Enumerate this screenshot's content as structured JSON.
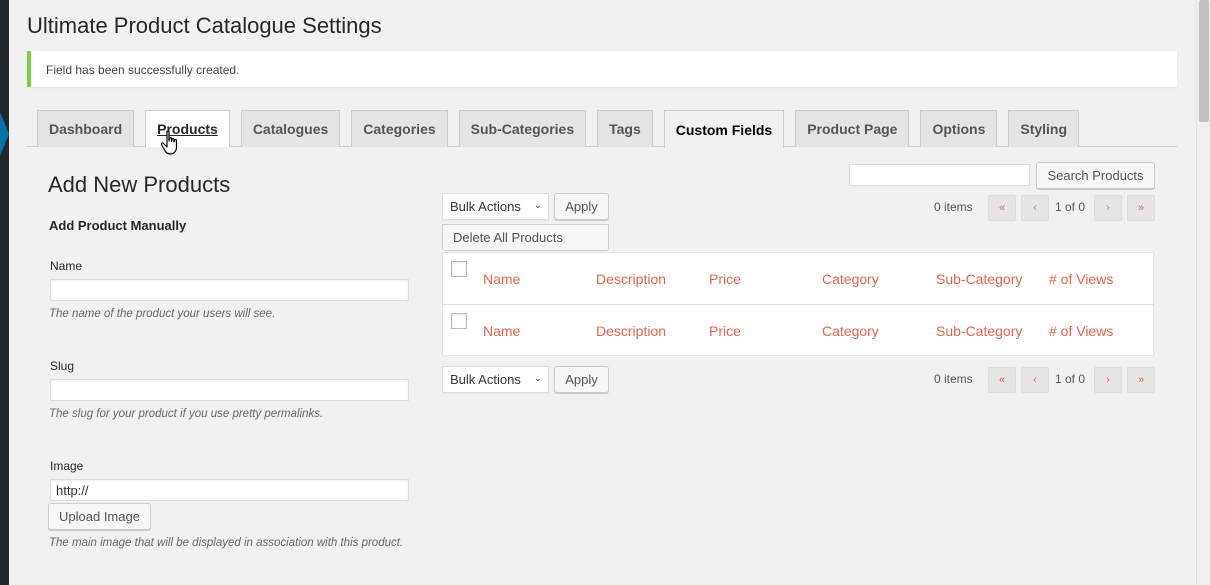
{
  "page": {
    "title": "Ultimate Product Catalogue Settings",
    "notice": "Field has been successfully created."
  },
  "tabs": [
    {
      "label": "Dashboard"
    },
    {
      "label": "Products"
    },
    {
      "label": "Catalogues"
    },
    {
      "label": "Categories"
    },
    {
      "label": "Sub-Categories"
    },
    {
      "label": "Tags"
    },
    {
      "label": "Custom Fields"
    },
    {
      "label": "Product Page"
    },
    {
      "label": "Options"
    },
    {
      "label": "Styling"
    }
  ],
  "form": {
    "heading": "Add New Products",
    "subheading": "Add Product Manually",
    "name_label": "Name",
    "name_value": "",
    "name_desc": "The name of the product your users will see.",
    "slug_label": "Slug",
    "slug_value": "",
    "slug_desc": "The slug for your product if you use pretty permalinks.",
    "image_label": "Image",
    "image_value": "http://",
    "upload_button": "Upload Image",
    "image_desc": "The main image that will be displayed in association with this product."
  },
  "list": {
    "search_value": "",
    "search_button": "Search Products",
    "bulk_actions": "Bulk Actions",
    "apply": "Apply",
    "delete_all": "Delete All Products",
    "items_count": "0 items",
    "pagination": {
      "first": "«",
      "prev": "‹",
      "current": "1 of 0",
      "next": "›",
      "last": "»"
    },
    "columns": [
      "Name",
      "Description",
      "Price",
      "Category",
      "Sub-Category",
      "# of Views"
    ]
  },
  "colors": {
    "link_orange": "#e86450",
    "notice_green": "#7ad03a"
  }
}
